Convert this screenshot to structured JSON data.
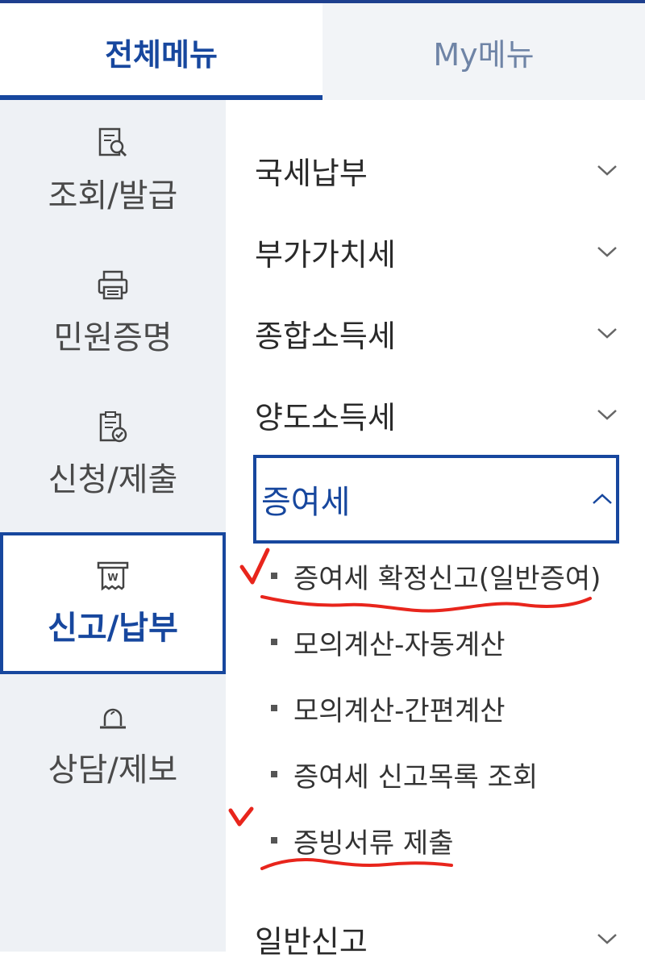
{
  "tabs": {
    "all": "전체메뉴",
    "my": "My메뉴"
  },
  "categories": [
    {
      "label": "조회/발급",
      "icon": "search-document-icon"
    },
    {
      "label": "민원증명",
      "icon": "printer-icon"
    },
    {
      "label": "신청/제출",
      "icon": "clipboard-check-icon"
    },
    {
      "label": "신고/납부",
      "icon": "receipt-won-icon",
      "active": true
    },
    {
      "label": "상담/제보",
      "icon": "siren-icon"
    }
  ],
  "menu": {
    "items": [
      {
        "label": "국세납부"
      },
      {
        "label": "부가가치세"
      },
      {
        "label": "종합소득세"
      },
      {
        "label": "양도소득세"
      },
      {
        "label": "증여세",
        "expanded": true
      },
      {
        "label": "일반신고"
      }
    ],
    "subitems": [
      {
        "label": "증여세 확정신고(일반증여)"
      },
      {
        "label": "모의계산-자동계산"
      },
      {
        "label": "모의계산-간편계산"
      },
      {
        "label": "증여세 신고목록 조회"
      },
      {
        "label": "증빙서류 제출"
      }
    ]
  },
  "colors": {
    "accent": "#17479e",
    "annotation": "#e8251c",
    "leftBg": "#eef1f5"
  }
}
